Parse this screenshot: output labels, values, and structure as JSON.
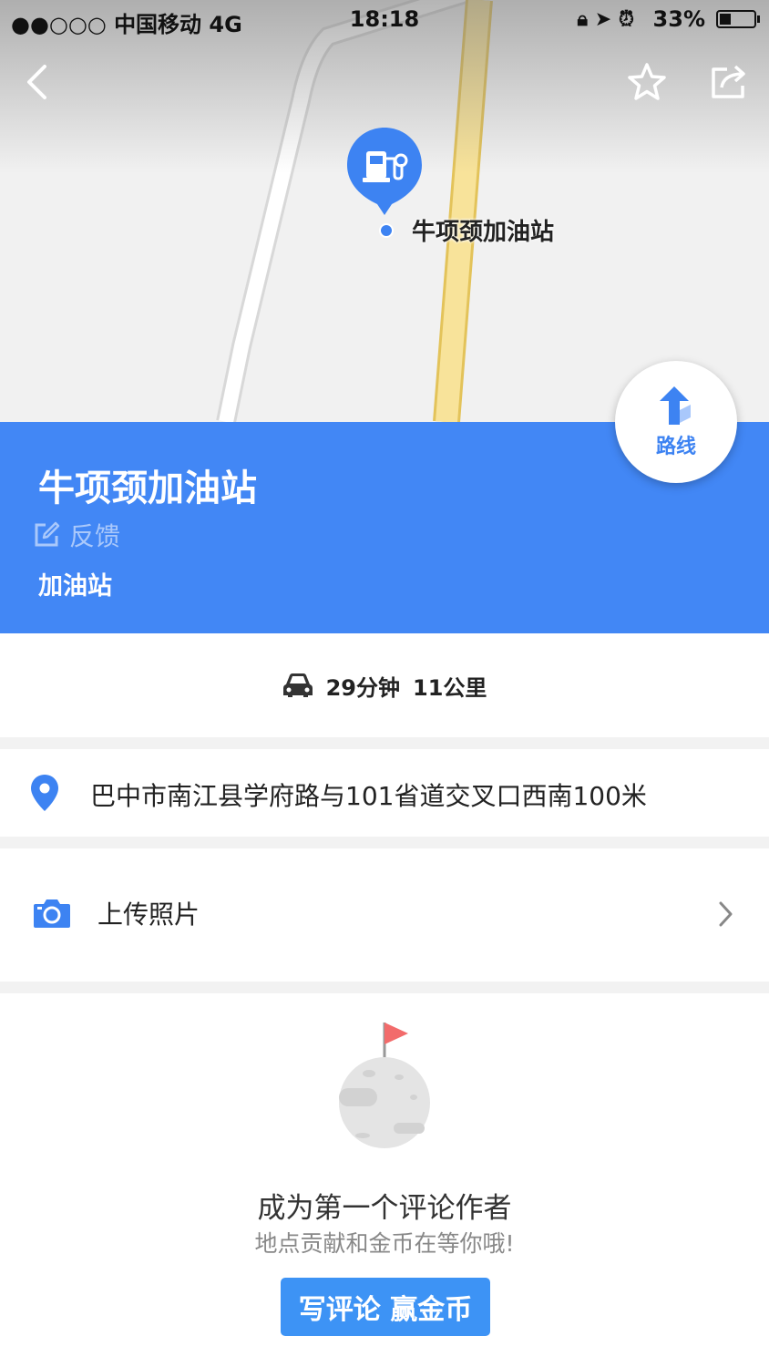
{
  "status_bar": {
    "carrier": "●●○○○ 中国移动  4G",
    "time": "18:18",
    "battery": "33%",
    "battery_level": 0.33
  },
  "nav": {
    "back_icon": "chevron-left-icon",
    "favorite_icon": "star-outline-icon",
    "share_icon": "share-icon"
  },
  "map": {
    "poi_label": "牛项颈加油站",
    "poi_icon": "gas-station-icon",
    "road_color": "#f5d76e"
  },
  "place": {
    "title": "牛项颈加油站",
    "feedback_label": "反馈",
    "category": "加油站",
    "route_label": "路线"
  },
  "drive": {
    "duration": "29分钟",
    "distance": "11公里"
  },
  "address": {
    "text": "巴中市南江县学府路与101省道交叉口西南100米"
  },
  "photo": {
    "label": "上传照片"
  },
  "review": {
    "title": "成为第一个评论作者",
    "subtitle": "地点贡献和金币在等你哦!",
    "button_label": "写评论 赢金币"
  },
  "colors": {
    "accent": "#4287f5",
    "button": "#3d93f5"
  }
}
